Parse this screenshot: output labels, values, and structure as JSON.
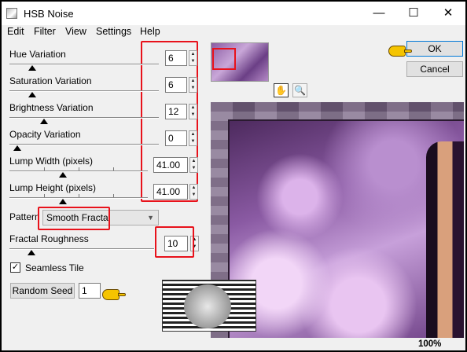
{
  "window": {
    "title": "HSB Noise",
    "minimize_glyph": "—",
    "maximize_glyph": "☐",
    "close_glyph": "✕"
  },
  "menu": [
    "Edit",
    "Filter",
    "View",
    "Settings",
    "Help"
  ],
  "params": [
    {
      "label": "Hue Variation",
      "value": "6",
      "slider_fraction": 0.1
    },
    {
      "label": "Saturation Variation",
      "value": "6",
      "slider_fraction": 0.1
    },
    {
      "label": "Brightness Variation",
      "value": "12",
      "slider_fraction": 0.18
    },
    {
      "label": "Opacity Variation",
      "value": "0",
      "slider_fraction": 0.0
    },
    {
      "label": "Lump Width (pixels)",
      "value": "41.00",
      "slider_fraction": 0.33
    },
    {
      "label": "Lump Height (pixels)",
      "value": "41.00",
      "slider_fraction": 0.33
    }
  ],
  "pattern": {
    "label": "Pattern",
    "value": "Smooth Fractal"
  },
  "roughness": {
    "label": "Fractal Roughness",
    "value": "10",
    "slider_fraction": 0.1
  },
  "seamless": {
    "label": "Seamless Tile",
    "checked": true,
    "check_glyph": "✓"
  },
  "seed": {
    "button_label": "Random Seed",
    "value": "1"
  },
  "buttons": {
    "ok": "OK",
    "cancel": "Cancel"
  },
  "preview": {
    "zoom": "100%",
    "pan_glyph": "✋",
    "zoom_glyph": "🔍"
  },
  "colors": {
    "highlight": "#e8121b",
    "pointer": "#f5c400"
  }
}
